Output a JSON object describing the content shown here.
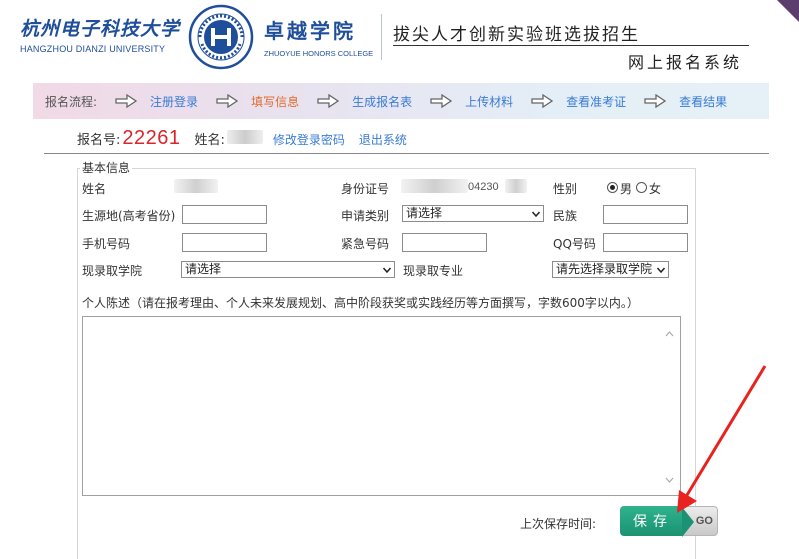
{
  "header": {
    "hdu_name_cn": "杭州电子科技大学",
    "hdu_name_en": "HANGZHOU DIANZI UNIVERSITY",
    "honors_name_cn": "卓越学院",
    "honors_name_en": "ZHUOYUE HONORS COLLEGE",
    "slogan": "拔尖人才创新实验班选拔招生",
    "system_name": "网上报名系统"
  },
  "process": {
    "label": "报名流程:",
    "steps": [
      {
        "label": "注册登录",
        "active": false
      },
      {
        "label": "填写信息",
        "active": true
      },
      {
        "label": "生成报名表",
        "active": false
      },
      {
        "label": "上传材料",
        "active": false
      },
      {
        "label": "查看准考证",
        "active": false
      },
      {
        "label": "查看结果",
        "active": false
      }
    ]
  },
  "user": {
    "reg_label": "报名号:",
    "reg_number": "22261",
    "name_label": "姓名:",
    "change_password": "修改登录密码",
    "logout": "退出系统"
  },
  "form": {
    "legend": "基本信息",
    "name_label": "姓名",
    "id_label": "身份证号",
    "id_visible_part": "04230",
    "gender_label": "性别",
    "gender_options": [
      "男",
      "女"
    ],
    "gender_selected": "男",
    "origin_label": "生源地(高考省份)",
    "apply_type_label": "申请类别",
    "apply_type_value": "请选择",
    "ethnicity_label": "民族",
    "phone_label": "手机号码",
    "emergency_label": "紧急号码",
    "qq_label": "QQ号码",
    "college_label": "现录取学院",
    "college_value": "请选择",
    "major_label": "现录取专业",
    "major_value": "请先选择录取学院",
    "statement_label": "个人陈述（请在报考理由、个人未来发展规划、高中阶段获奖或实践经历等方面撰写，字数600字以内。）",
    "last_save_label": "上次保存时间:"
  },
  "buttons": {
    "save": "保存",
    "go": "GO"
  },
  "colors": {
    "brand_blue": "#1f4e9a",
    "link_blue": "#3a7bd5",
    "active_step": "#e26a2c",
    "reg_number_red": "#d8262b",
    "save_green": "#1b9273",
    "annotation_red": "#e8231f"
  }
}
